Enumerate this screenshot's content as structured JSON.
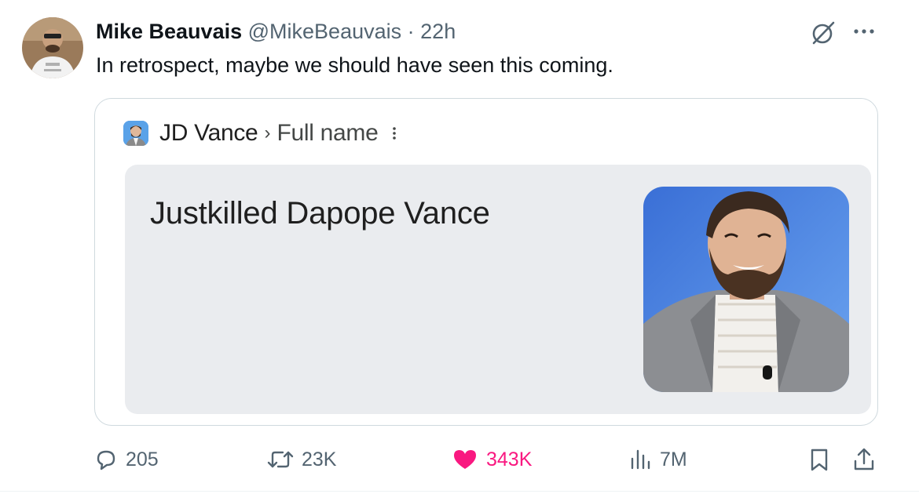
{
  "tweet": {
    "author_name": "Mike Beauvais",
    "author_handle": "@MikeBeauvais",
    "separator": "·",
    "timestamp": "22h",
    "text": "In retrospect, maybe we should have seen this coming."
  },
  "embedded_card": {
    "entity_name": "JD Vance",
    "breadcrumb_chevron": "›",
    "attribute": "Full name",
    "answer": "Justkilled Dapope Vance"
  },
  "actions": {
    "replies": "205",
    "reposts": "23K",
    "likes": "343K",
    "views": "7M"
  },
  "colors": {
    "text_primary": "#0f1419",
    "text_secondary": "#536471",
    "like_pink": "#f91880",
    "card_border": "#cfd9de",
    "answer_box_bg": "#eaecef"
  },
  "icons": [
    "grok-icon",
    "more-icon",
    "more-vert-icon",
    "reply-icon",
    "retweet-icon",
    "like-heart-icon",
    "views-icon",
    "bookmark-icon",
    "share-icon"
  ]
}
